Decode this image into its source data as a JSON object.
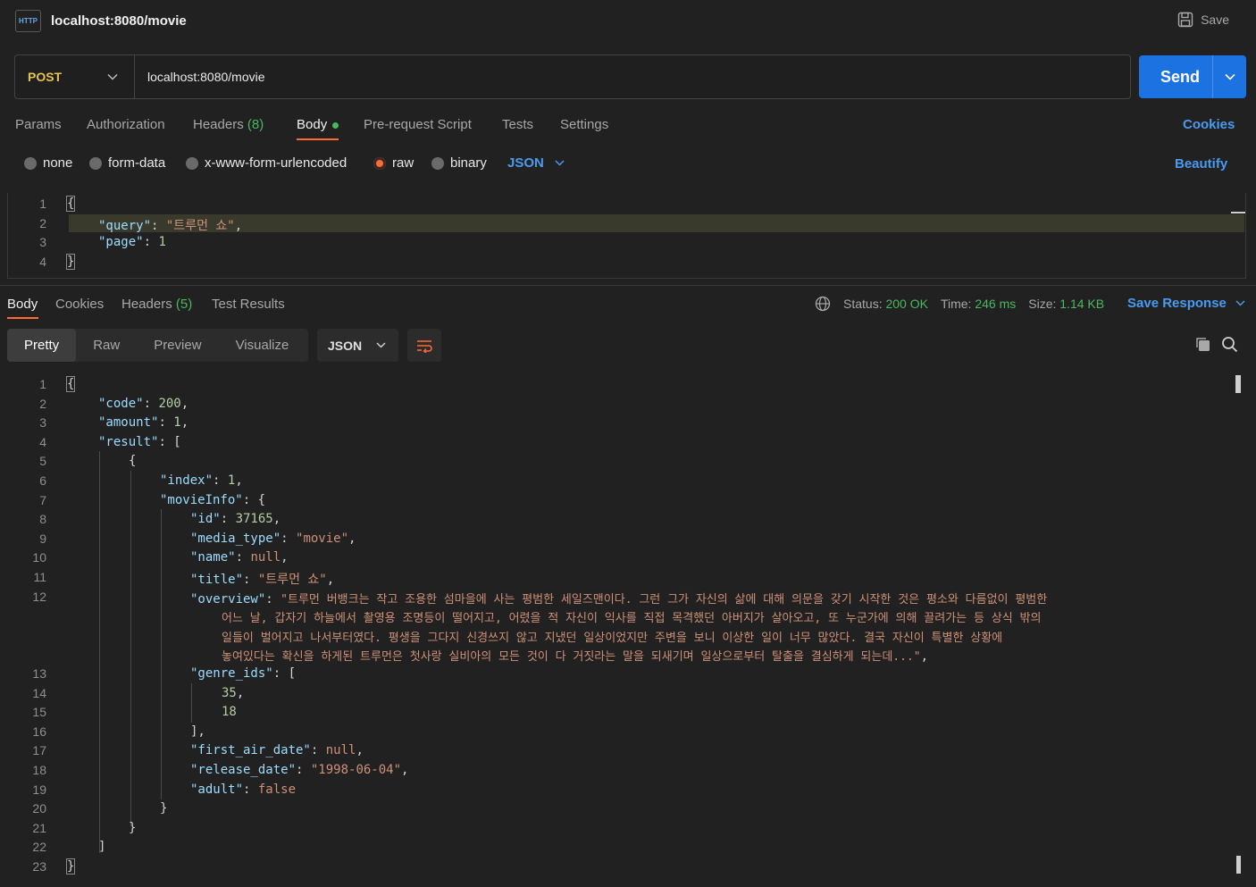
{
  "header": {
    "icon_text": "HTTP",
    "title": "localhost:8080/movie",
    "save_label": "Save"
  },
  "request": {
    "method": "POST",
    "url": "localhost:8080/movie",
    "send_label": "Send",
    "tabs": {
      "params": "Params",
      "authorization": "Authorization",
      "headers": "Headers",
      "headers_count": "(8)",
      "body": "Body",
      "prerequest": "Pre-request Script",
      "tests": "Tests",
      "settings": "Settings"
    },
    "cookies_label": "Cookies",
    "body_types": {
      "none": "none",
      "form_data": "form-data",
      "urlencoded": "x-www-form-urlencoded",
      "raw": "raw",
      "binary": "binary"
    },
    "language": "JSON",
    "beautify_label": "Beautify",
    "lines": [
      "1",
      "2",
      "3",
      "4"
    ],
    "code": {
      "open": "{",
      "l2_key": "\"query\"",
      "l2_val": "\"트루먼 쇼\"",
      "l3_key": "\"page\"",
      "l3_val": "1",
      "close": "}"
    }
  },
  "response": {
    "tabs": {
      "body": "Body",
      "cookies": "Cookies",
      "headers": "Headers",
      "headers_count": "(5)",
      "test_results": "Test Results"
    },
    "status_label": "Status:",
    "status_value": "200 OK",
    "time_label": "Time:",
    "time_value": "246 ms",
    "size_label": "Size:",
    "size_value": "1.14 KB",
    "save_response_label": "Save Response",
    "views": {
      "pretty": "Pretty",
      "raw": "Raw",
      "preview": "Preview",
      "visualize": "Visualize"
    },
    "format": "JSON",
    "lines": [
      "1",
      "2",
      "3",
      "4",
      "5",
      "6",
      "7",
      "8",
      "9",
      "10",
      "11",
      "12",
      "13",
      "14",
      "15",
      "16",
      "17",
      "18",
      "19",
      "20",
      "21",
      "22",
      "23"
    ],
    "code": {
      "code_key": "\"code\"",
      "code_val": "200",
      "amount_key": "\"amount\"",
      "amount_val": "1",
      "result_key": "\"result\"",
      "index_key": "\"index\"",
      "index_val": "1",
      "movieinfo_key": "\"movieInfo\"",
      "id_key": "\"id\"",
      "id_val": "37165",
      "media_type_key": "\"media_type\"",
      "media_type_val": "\"movie\"",
      "name_key": "\"name\"",
      "name_val": "null",
      "title_key": "\"title\"",
      "title_val": "\"트루먼 쇼\"",
      "overview_key": "\"overview\"",
      "overview_l1": "\"트루먼 버뱅크는 작고 조용한 섬마을에 사는 평범한 세일즈맨이다. 그런 그가 자신의 삶에 대해 의문을 갖기 시작한 것은 평소와 다름없이 평범한",
      "overview_l2": "어느 날, 갑자기 하늘에서 촬영용 조명등이 떨어지고, 어렸을 적 자신이 익사를 직접 목격했던 아버지가 살아오고, 또 누군가에 의해 끌려가는 등 상식 밖의",
      "overview_l3": "일들이 벌어지고 나서부터였다. 평생을 그다지 신경쓰지 않고 지냈던 일상이었지만 주변을 보니 이상한 일이 너무 많았다. 결국 자신이 특별한 상황에",
      "overview_l4": "놓여있다는 확신을 하게된 트루먼은 첫사랑 실비아의 모든 것이 다 거짓라는 말을 되새기며 일상으로부터 탈출을 결심하게 되는데...\"",
      "genre_ids_key": "\"genre_ids\"",
      "genre_1": "35",
      "genre_2": "18",
      "first_air_date_key": "\"first_air_date\"",
      "first_air_date_val": "null",
      "release_date_key": "\"release_date\"",
      "release_date_val": "\"1998-06-04\"",
      "adult_key": "\"adult\"",
      "adult_val": "false"
    }
  },
  "colors": {
    "accent": "#ff6c37",
    "send": "#1c72e0",
    "link": "#4a9bf0",
    "ok": "#49b85f",
    "method": "#e6c34a"
  }
}
